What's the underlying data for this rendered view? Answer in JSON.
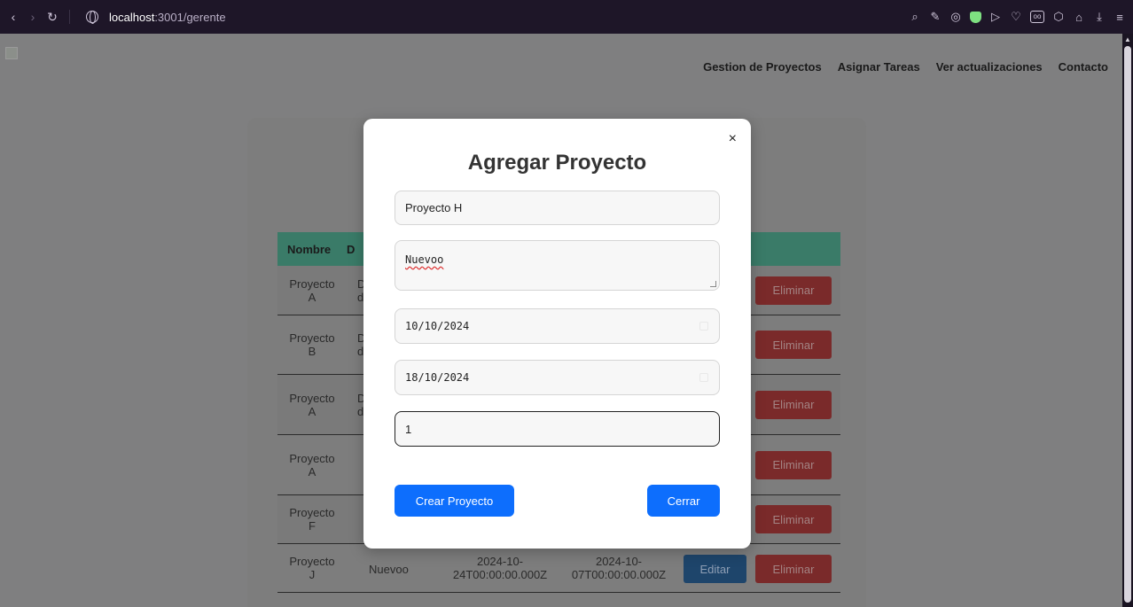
{
  "browser": {
    "url_host": "localhost",
    "url_path": ":3001/gerente"
  },
  "nav": {
    "items": [
      "Gestion de Proyectos",
      "Asignar Tareas",
      "Ver actualizaciones",
      "Contacto"
    ]
  },
  "table": {
    "headers": [
      "Nombre",
      "D"
    ],
    "delete_label": "Eliminar",
    "edit_label": "Editar",
    "rows": [
      {
        "name_line1": "Proyecto",
        "name_line2": "A",
        "desc_line1": "D",
        "desc_line2": "d"
      },
      {
        "name_line1": "Proyecto",
        "name_line2": "B",
        "desc_line1": "D",
        "desc_line2": "d"
      },
      {
        "name_line1": "Proyecto",
        "name_line2": "A",
        "desc_line1": "D",
        "desc_line2": "d"
      },
      {
        "name_line1": "Proyecto",
        "name_line2": "A",
        "desc_line1": "",
        "desc_line2": ""
      },
      {
        "name_line1": "Proyecto",
        "name_line2": "F",
        "desc_line1": "",
        "desc_line2": ""
      }
    ],
    "last_row": {
      "name_line1": "Proyecto",
      "name_line2": "J",
      "desc": "Nuevoo",
      "start_line1": "2024-10-",
      "start_line2": "24T00:00:00.000Z",
      "end_line1": "2024-10-",
      "end_line2": "07T00:00:00.000Z"
    }
  },
  "modal": {
    "title": "Agregar Proyecto",
    "close": "×",
    "name_value": "Proyecto H",
    "description_value": "Nuevoo",
    "start_date_value": "10/10/2024",
    "end_date_value": "18/10/2024",
    "manager_value": "1",
    "create_label": "Crear Proyecto",
    "close_label": "Cerrar"
  }
}
